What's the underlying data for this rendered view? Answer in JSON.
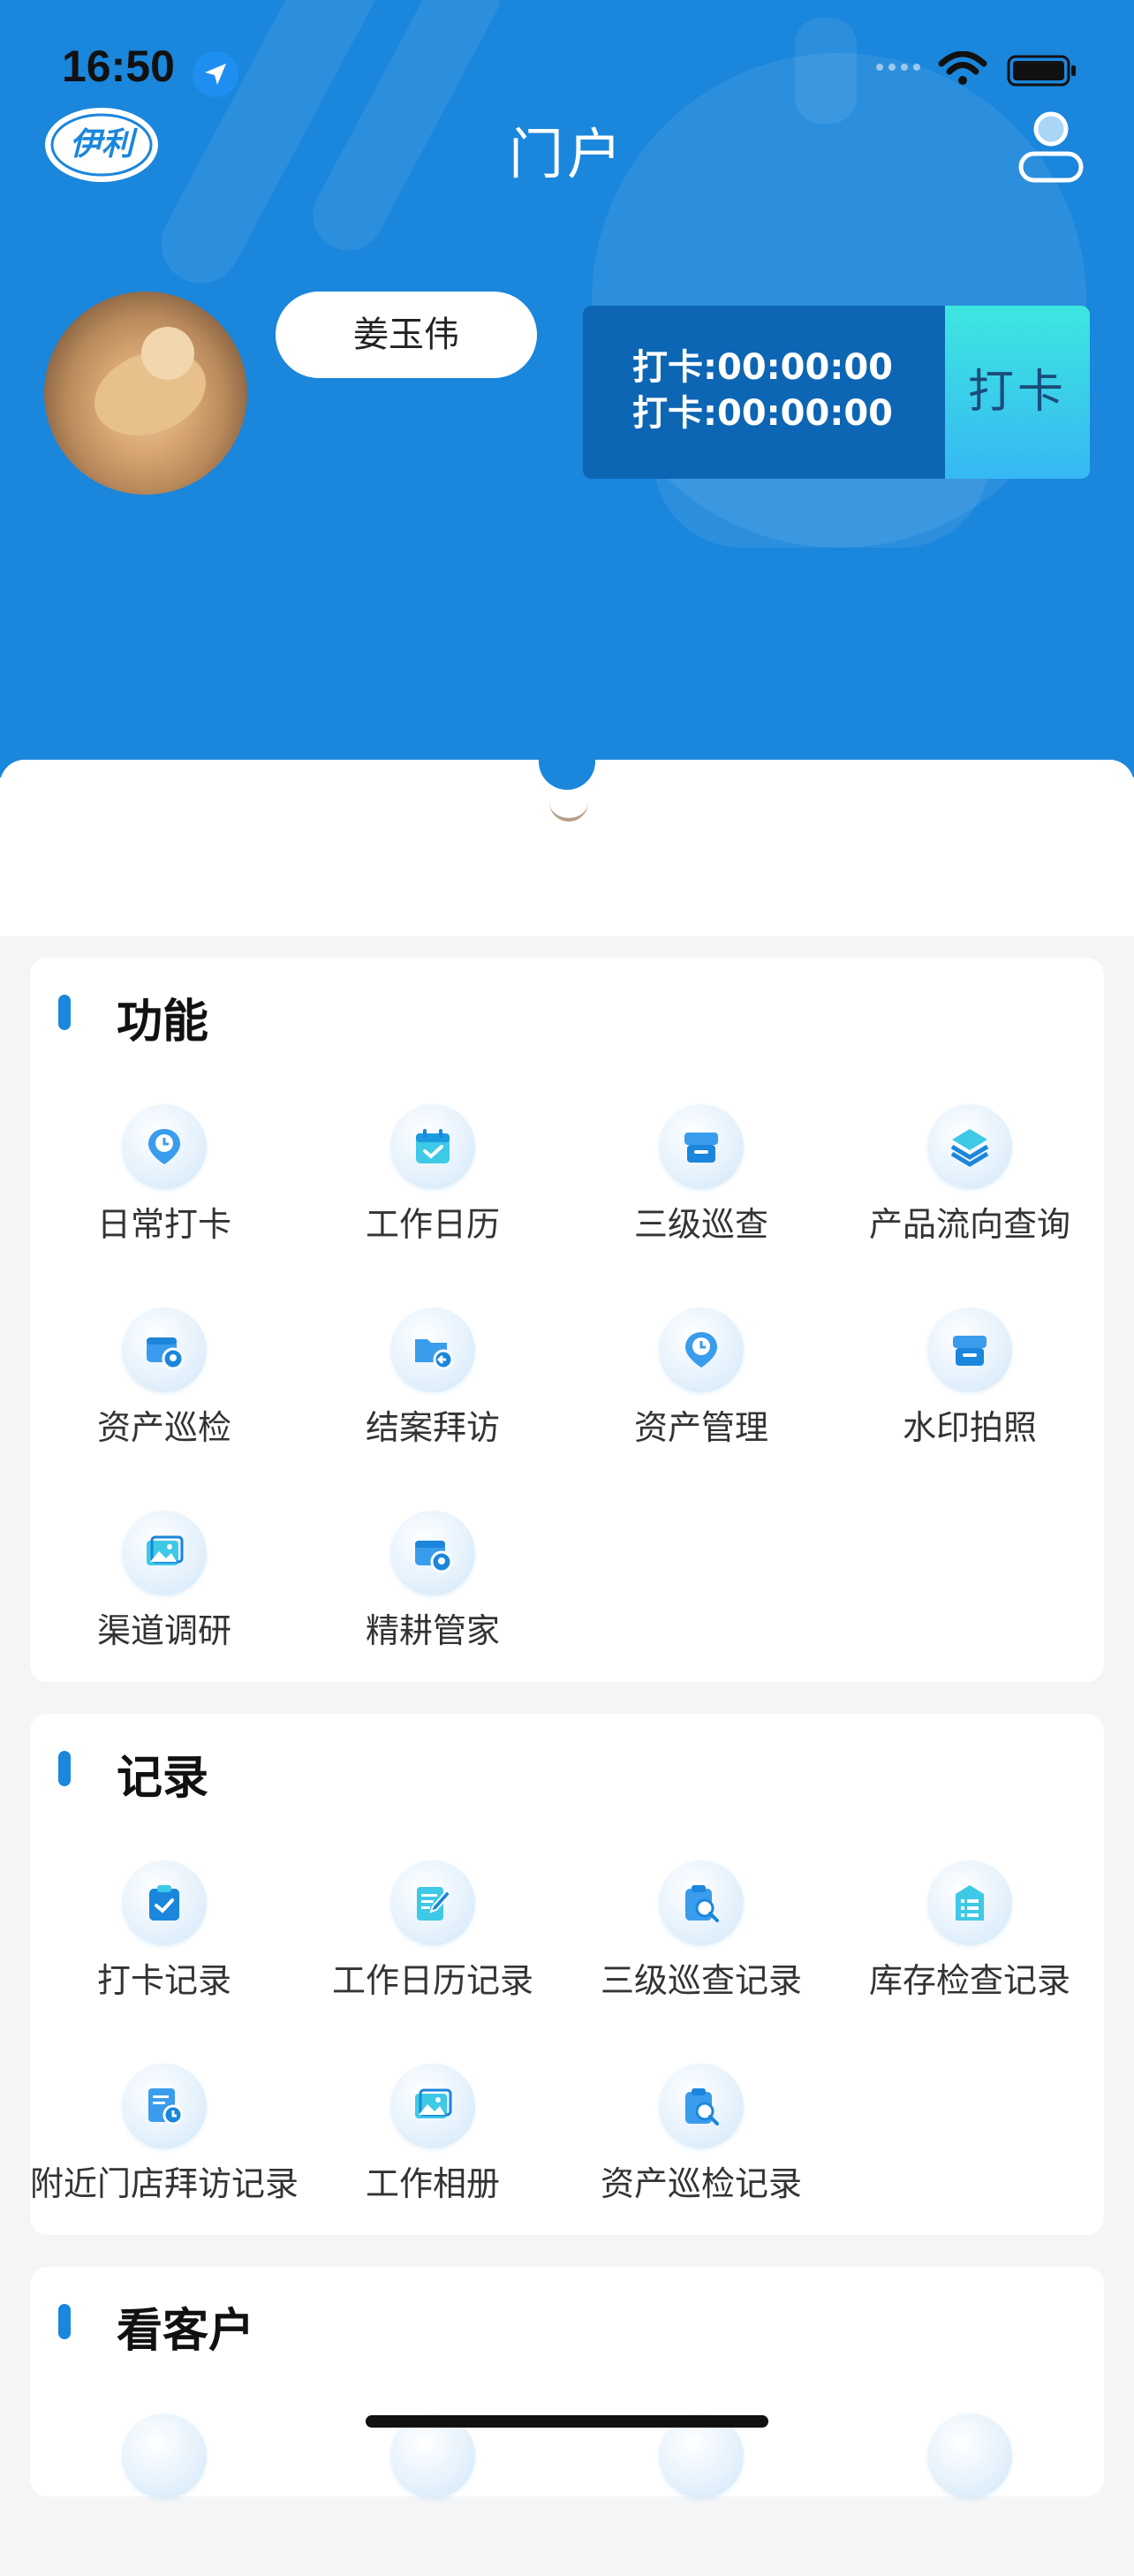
{
  "status": {
    "time": "16:50"
  },
  "header": {
    "logo_text": "伊利",
    "title": "门户"
  },
  "profile": {
    "name": "姜玉伟",
    "clock_in_1": "打卡:00:00:00",
    "clock_in_2": "打卡:00:00:00",
    "clock_button": "打卡"
  },
  "sections": {
    "functions": {
      "title": "功能",
      "items": [
        "日常打卡",
        "工作日历",
        "三级巡查",
        "产品流向查询",
        "资产巡检",
        "结案拜访",
        "资产管理",
        "水印拍照",
        "渠道调研",
        "精耕管家"
      ]
    },
    "records": {
      "title": "记录",
      "items": [
        "打卡记录",
        "工作日历记录",
        "三级巡查记录",
        "库存检查记录",
        "附近门店拜访记录",
        "工作相册",
        "资产巡检记录"
      ]
    },
    "customers": {
      "title": "看客户"
    }
  },
  "colors": {
    "brand_blue": "#1a86dc",
    "button_cyan": "#3ee6e0",
    "panel_dark": "#0d66b4"
  }
}
